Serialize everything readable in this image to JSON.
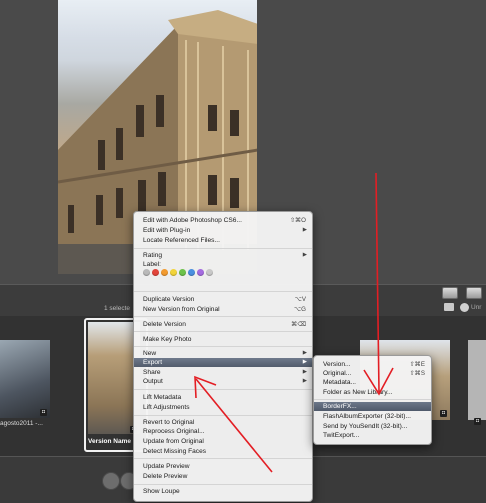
{
  "browser": {
    "selected_count": "1 selecte",
    "unrated_label": "Unr",
    "thumbs": [
      {
        "caption": "agosto2011 -..."
      },
      {
        "caption": "Version Name"
      },
      {
        "caption": ""
      }
    ]
  },
  "context_menu": {
    "items": [
      {
        "label": "Edit with Adobe Photoshop CS6...",
        "shortcut": "⇧⌘O"
      },
      {
        "label": "Edit with Plug-in",
        "submenu": true
      },
      {
        "label": "Locate Referenced Files..."
      },
      {
        "label": "Rating",
        "submenu": true
      },
      {
        "label": "Label:"
      },
      {
        "label": "Duplicate Version",
        "shortcut": "⌥V"
      },
      {
        "label": "New Version from Original",
        "shortcut": "⌥G"
      },
      {
        "label": "Delete Version",
        "shortcut": "⌘⌫"
      },
      {
        "label": "Make Key Photo"
      },
      {
        "label": "New",
        "submenu": true
      },
      {
        "label": "Export",
        "submenu": true,
        "highlighted": true
      },
      {
        "label": "Share",
        "submenu": true
      },
      {
        "label": "Output",
        "submenu": true
      },
      {
        "label": "Lift Metadata"
      },
      {
        "label": "Lift Adjustments"
      },
      {
        "label": "Revert to Original"
      },
      {
        "label": "Reprocess Original..."
      },
      {
        "label": "Update from Original"
      },
      {
        "label": "Detect Missing Faces"
      },
      {
        "label": "Update Preview"
      },
      {
        "label": "Delete Preview"
      },
      {
        "label": "Show Loupe"
      }
    ],
    "label_colors": [
      "#b9b9b9",
      "#e2453b",
      "#f29a2e",
      "#f2d43a",
      "#6cc24a",
      "#4a8fe0",
      "#a46be0",
      "#c8c8c8"
    ]
  },
  "export_submenu": {
    "items": [
      {
        "label": "Version...",
        "shortcut": "⇧⌘E"
      },
      {
        "label": "Original...",
        "shortcut": "⇧⌘S"
      },
      {
        "label": "Metadata..."
      },
      {
        "label": "Folder as New Library..."
      },
      {
        "label": "BorderFX...",
        "highlighted": true
      },
      {
        "label": "FlashAlbumExporter (32-bit)..."
      },
      {
        "label": "Send by YouSendIt (32-bit)..."
      },
      {
        "label": "TwitExport..."
      }
    ]
  },
  "colors": {
    "annotation_arrow": "#e31e24",
    "menu_highlight": "#5b6577"
  }
}
